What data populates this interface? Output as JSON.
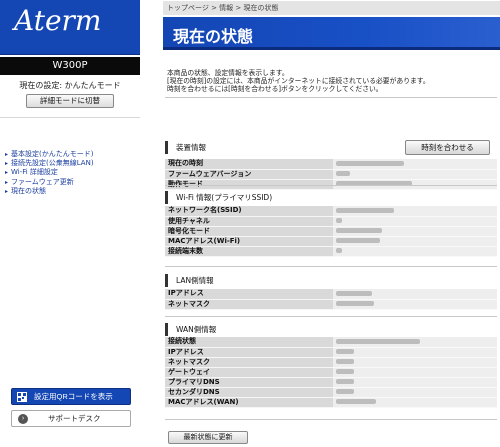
{
  "sidebar": {
    "logo": "Aterm",
    "model": "W300P",
    "mode_text": "現在の設定: かんたんモード",
    "detail_button": "詳細モードに切替",
    "nav": [
      "基本設定(かんたんモード)",
      "接続先設定(公衆無線LAN)",
      "Wi-Fi 詳細設定",
      "ファームウェア更新",
      "現在の状態"
    ],
    "qr_button": "設定用QRコードを表示",
    "support_button": "サポートデスク"
  },
  "main": {
    "breadcrumb": "トップページ > 情報 > 現在の状態",
    "title": "現在の状態",
    "description": [
      "本商品の状態、設定情報を表示します。",
      "[現在の時刻]の設定には、本商品がインターネットに接続されている必要があります。",
      "時刻を合わせるには[時刻を合わせる]ボタンをクリックしてください。"
    ],
    "sync_button": "時刻を合わせる",
    "refresh_button": "最新状態に更新",
    "sections": [
      {
        "title": "装置情報",
        "rows": [
          "現在の時刻",
          "ファームウェアバージョン",
          "動作モード"
        ]
      },
      {
        "title": "Wi-Fi 情報(プライマリSSID)",
        "rows": [
          "ネットワーク名(SSID)",
          "使用チャネル",
          "暗号化モード",
          "MACアドレス(Wi-Fi)",
          "接続端末数"
        ]
      },
      {
        "title": "LAN側情報",
        "rows": [
          "IPアドレス",
          "ネットマスク"
        ]
      },
      {
        "title": "WAN側情報",
        "rows": [
          "接続状態",
          "IPアドレス",
          "ネットマスク",
          "ゲートウェイ",
          "プライマリDNS",
          "セカンダリDNS",
          "MACアドレス(WAN)"
        ]
      }
    ]
  },
  "colors": {
    "brand": "#1446b4",
    "model_bar": "#0a0a0a",
    "link": "#1a3ea0"
  }
}
